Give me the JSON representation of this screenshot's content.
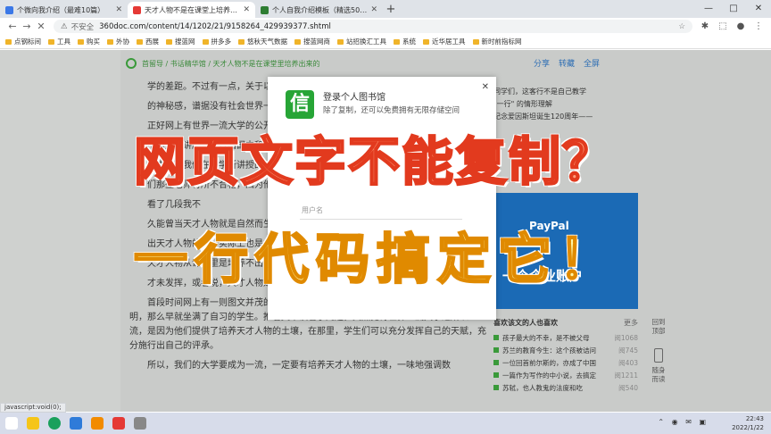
{
  "browser": {
    "tabs": [
      {
        "title": "个微向我介绍（最难10篇）",
        "favicon_color": "#3b78e7",
        "active": false
      },
      {
        "title": "天才人物不是在课堂上培养出来的",
        "favicon_color": "#e53935",
        "active": true
      },
      {
        "title": "个人自我介绍模板（精选50篇）",
        "favicon_color": "#2e7d32",
        "active": false
      }
    ],
    "window_controls": [
      "—",
      "□",
      "✕"
    ],
    "address": {
      "security_label": "不安全",
      "url": "360doc.com/content/14/1202/21/9158264_429939377.shtml"
    },
    "bookmarks": [
      "点钢标间",
      "工具",
      "购买",
      "外协",
      "西展",
      "搜蓝网",
      "拼多多",
      "悠秋天气数据",
      "搜蓝网商",
      "站招换汇工具",
      "系统",
      "近华居工具",
      "新时前指标网"
    ]
  },
  "page": {
    "breadcrumb": "首留导 / 书话精华馆 / 天才人物不是在课堂里培养出来的",
    "actions": {
      "share": "分享",
      "save": "转藏",
      "fullscreen": "全屏"
    },
    "article_paragraphs": [
      "学的差距。不过有一点，关于以上，他们有着卓越的",
      "的神秘感，谱据没有社会世界一",
      "正好网上有世界一流大学的公开课",
      "中的大学讲座，不过由国内和",
      "话内容都我们在大学所讲授的，人们都",
      "们那些老师有所不合格，因为他们",
      "看了几段我不",
      "久能曾当天才人物就是自然而生成的",
      "出天才人物的地，实际上也是并不",
      "天才人物从课堂里是培养不出来的",
      "才未发挥，或者说，天才人物是自由和大环境下生长的结果，不是在课堂里被培养的。",
      "首段时间网上有一则图文并茂的文章，介绍给哈佛大学图书馆凌晨四点半馆堂内灯火通明，那么早就坐满了自习的学生。推着文章读看了几遍，突然觉得世界一流大学之所以一流，是因为他们提供了培养天才人物的土壤，在那里，学生们可以充分发挥自己的天赋，充分施行出自己的评承。",
      "所以，我们的大学要成为一流，一定要有培养天才人物的土壤，一味地强调数"
    ],
    "sidebar_items": [
      "同学们，这客行不是自己教学",
      "\"一行\" 的情形理解",
      "纪念爱因斯坦诞生120周年——"
    ],
    "ad": {
      "brand": "PayPal",
      "text": "一个企业账户"
    },
    "fav_list": {
      "title": "喜欢该文的人也喜欢",
      "more": "更多",
      "rows": [
        {
          "title": "孩子最大的不幸，是不被父母",
          "count": "阅1068"
        },
        {
          "title": "苏兰的教育今生：这个孩被诘问",
          "count": "阅745"
        },
        {
          "title": "一位回首前尔斯的，亦成了中国",
          "count": "阅403"
        },
        {
          "title": "一篇作为写作的中小说，去搞定",
          "count": "阅1211"
        },
        {
          "title": "苏轼，也人教鬼的法度和吃",
          "count": "阅540"
        }
      ]
    },
    "right_rail": {
      "back": "回到\n顶部",
      "mobile": "随身\n而读"
    }
  },
  "login_modal": {
    "logo_glyph": "信",
    "title": "登录个人图书馆",
    "subtitle": "除了复制，还可以免费拥有无限存储空间",
    "close": "✕",
    "input_placeholder": "用户名"
  },
  "overlay": {
    "line1": "网页文字不能复制？",
    "line2": "一行代码搞定它！"
  },
  "status_bar": "javascript:void(0);",
  "taskbar": {
    "time": "22:43",
    "date": "2022/1/22",
    "app_colors": [
      "#ffffff",
      "#f5c518",
      "#1aa05c",
      "#2f7bd9",
      "#f28b00",
      "#e53935",
      "#888888"
    ]
  }
}
